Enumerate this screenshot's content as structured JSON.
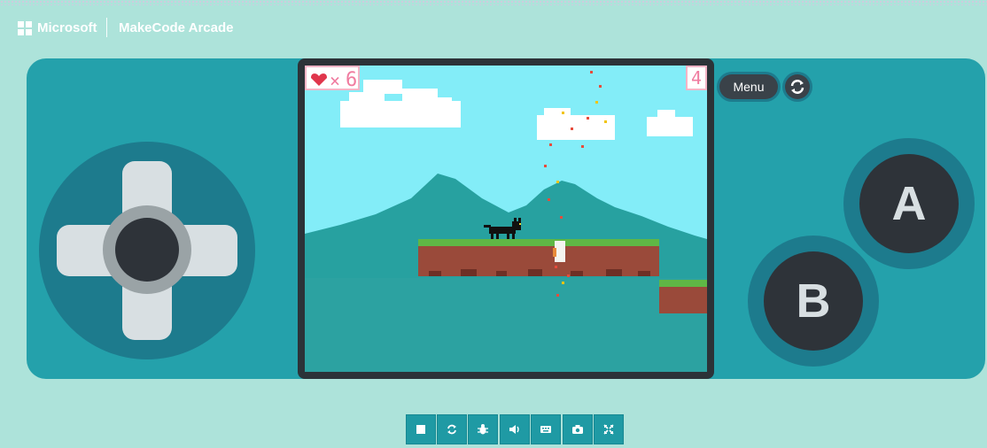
{
  "header": {
    "brand": "Microsoft",
    "app_name": "MakeCode Arcade"
  },
  "game": {
    "lives_symbol": "×",
    "lives": "6",
    "score": "4"
  },
  "controls": {
    "menu_label": "Menu",
    "a_label": "A",
    "b_label": "B"
  },
  "toolbar": {
    "buttons": [
      {
        "icon": "stop-icon"
      },
      {
        "icon": "restart-icon"
      },
      {
        "icon": "debug-bug-icon"
      },
      {
        "icon": "sound-icon"
      },
      {
        "icon": "keyboard-icon"
      },
      {
        "icon": "camera-icon"
      },
      {
        "icon": "fullscreen-icon"
      }
    ]
  },
  "colors": {
    "page_bg": "#ade3da",
    "console": "#24a1ab",
    "button_dark": "#2e3339",
    "accent_pink": "#f07ca0"
  }
}
